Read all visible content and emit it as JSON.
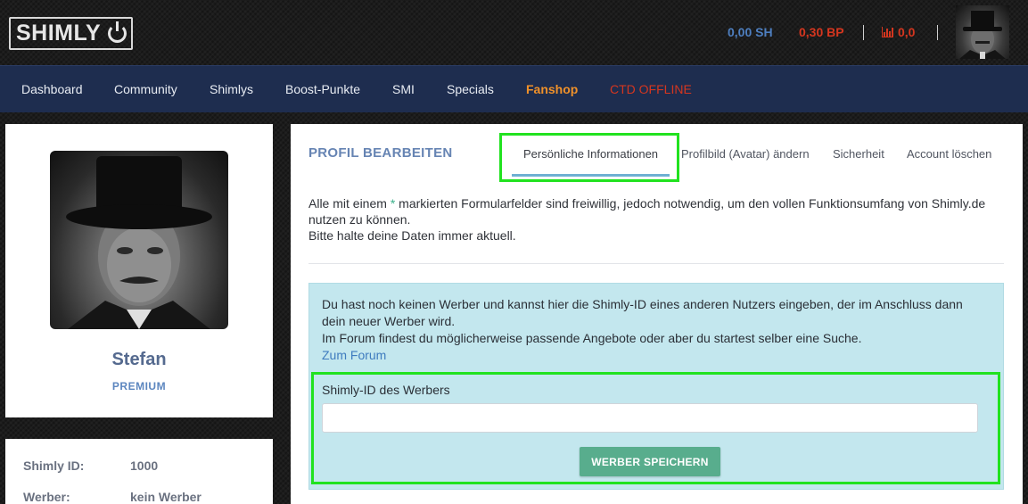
{
  "header": {
    "logo_text": "SHIMLY",
    "balance_sh": "0,00 SH",
    "balance_bp": "0,30 BP",
    "chart_value": "0,0"
  },
  "nav": {
    "items": [
      "Dashboard",
      "Community",
      "Shimlys",
      "Boost-Punkte",
      "SMI",
      "Specials",
      "Fanshop",
      "CTD OFFLINE"
    ]
  },
  "profile": {
    "name": "Stefan",
    "rank": "PREMIUM",
    "id_label": "Shimly ID:",
    "id_value": "1000",
    "recruiter_label": "Werber:",
    "recruiter_value": "kein Werber"
  },
  "edit": {
    "title": "PROFIL BEARBEITEN",
    "tabs": [
      "Persönliche Informationen",
      "Profilbild (Avatar) ändern",
      "Sicherheit",
      "Account löschen"
    ],
    "intro_before_star": "Alle mit einem ",
    "intro_star": "*",
    "intro_after_star": " markierten Formularfelder sind freiwillig, jedoch notwendig, um den vollen Funktionsumfang von Shimly.de nutzen zu können.",
    "intro_line2": "Bitte halte deine Daten immer aktuell.",
    "alert_line1": "Du hast noch keinen Werber und kannst hier die Shimly-ID eines anderen Nutzers eingeben, der im Anschluss dann dein neuer Werber wird.",
    "alert_line2": "Im Forum findest du möglicherweise passende Angebote oder aber du startest selber eine Suche.",
    "forum_link": "Zum Forum",
    "field_label": "Shimly-ID des Werbers",
    "field_value": "",
    "save_button": "WERBER SPEICHERN"
  },
  "colors": {
    "nav_bg": "#1e2d4f",
    "accent_blue": "#4e7fc0",
    "accent_red": "#d5361f",
    "fanshop_orange": "#f0912a",
    "highlight_green": "#21e21f",
    "button_green": "#58ad8d",
    "alert_bg": "#c3e7ee"
  }
}
